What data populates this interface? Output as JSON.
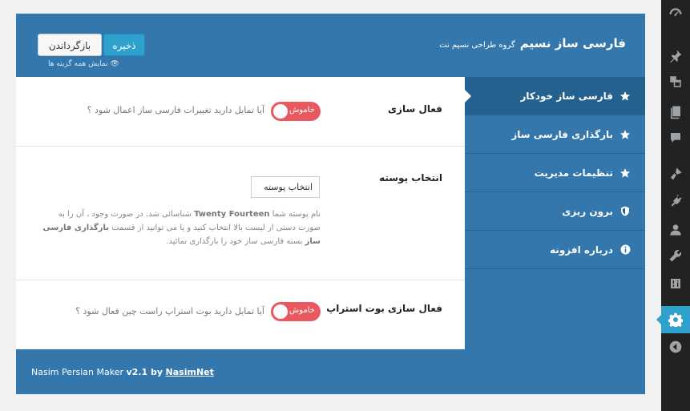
{
  "header": {
    "title": "فارسی ساز نسیم",
    "subtitle": "گروه طراحی نسیم نت",
    "save_label": "ذخیره",
    "reset_label": "بازگرداندن",
    "show_all_label": "نمایش همه گزینه ها"
  },
  "nav": {
    "items": [
      {
        "label": "فارسی ساز خودکار",
        "icon": "star-icon"
      },
      {
        "label": "بارگذاری فارسی ساز",
        "icon": "star-icon"
      },
      {
        "label": "تنظیمات مدیریت",
        "icon": "star-icon"
      },
      {
        "label": "برون ریزی",
        "icon": "shield-icon"
      },
      {
        "label": "درباره افزونه",
        "icon": "info-icon"
      }
    ]
  },
  "rows": {
    "activate": {
      "label": "فعال سازی",
      "toggle": "خاموش",
      "question": "آیا تمایل دارید تغییرات فارسی ساز اعمال شود ؟"
    },
    "skin": {
      "label": "انتخاب پوسته",
      "select_value": "انتخاب پوسته",
      "desc_1": "نام پوسته شما",
      "theme_name": "Twenty Fourteen",
      "desc_2": "شناسائی شد. در صورت وجود ، آن را به صورت دستی از لیست بالا انتخاب کنید و یا می توانید از قسمت",
      "bold_link": "بارگذاری فارسی ساز",
      "desc_3": "بسته فارسی ساز خود را بارگذاری نمائید."
    },
    "bootstrap": {
      "label": "فعال سازی بوت استراپ",
      "toggle": "خاموش",
      "question": "آیا تمایل دارید بوت استراپ راست چین فعال شود ؟"
    }
  },
  "footer": {
    "prefix": "Nasim Persian Maker",
    "version": "v2.1 by",
    "author": "NasimNet"
  },
  "colors": {
    "panel": "#3377ad",
    "active_nav": "#24618f",
    "toggle_off": "#e8585f",
    "save_button": "#2ea2cc",
    "admin_bar": "#222222"
  }
}
